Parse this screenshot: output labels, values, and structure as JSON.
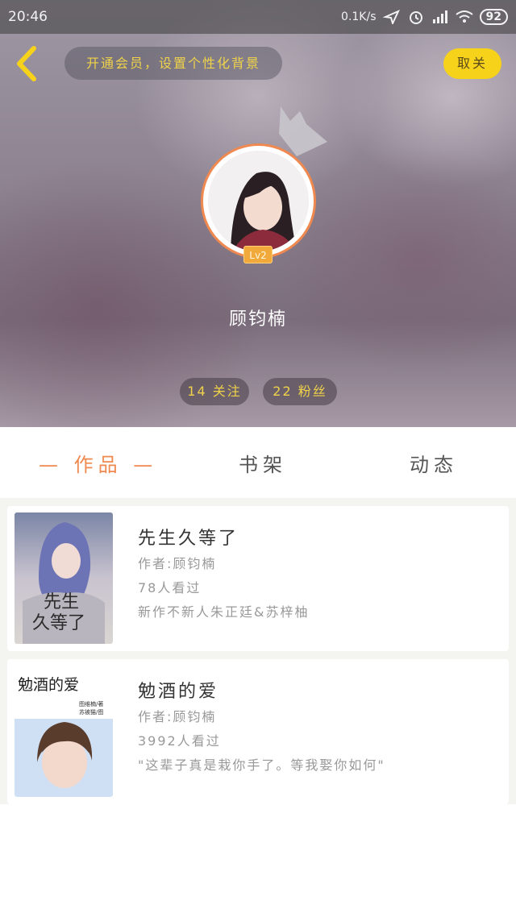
{
  "status_bar": {
    "time": "20:46",
    "network_speed": "0.1K/s",
    "battery": "92",
    "icons": [
      "location-icon",
      "alarm-icon",
      "signal-icon",
      "wifi-icon"
    ]
  },
  "header": {
    "back_icon": "chevron-left-icon",
    "vip_prompt": "开通会员，设置个性化背景",
    "unfollow_label": "取关"
  },
  "profile": {
    "level": "Lv2",
    "username": "顾钧楠",
    "following": "14 关注",
    "followers": "22 粉丝"
  },
  "tabs": [
    {
      "label": "— 作品 —",
      "active": true
    },
    {
      "label": "书架",
      "active": false
    },
    {
      "label": "动态",
      "active": false
    }
  ],
  "books": [
    {
      "title": "先生久等了",
      "author": "作者:顾钧楠",
      "views": "78人看过",
      "description": "新作不新人朱正廷&苏梓柚",
      "cover_text": "先生久等了"
    },
    {
      "title": "勉酒的爱",
      "author": "作者:顾钧楠",
      "views": "3992人看过",
      "description": "\"这辈子真是栽你手了。等我娶你如何\"",
      "cover_text": "勉酒的爱",
      "cover_credits": [
        "图维楠/著",
        "苏被猫/图"
      ]
    }
  ],
  "colors": {
    "accent": "#f0894f",
    "gold_text": "#f0d34a",
    "button_yellow": "#f7d21b"
  }
}
